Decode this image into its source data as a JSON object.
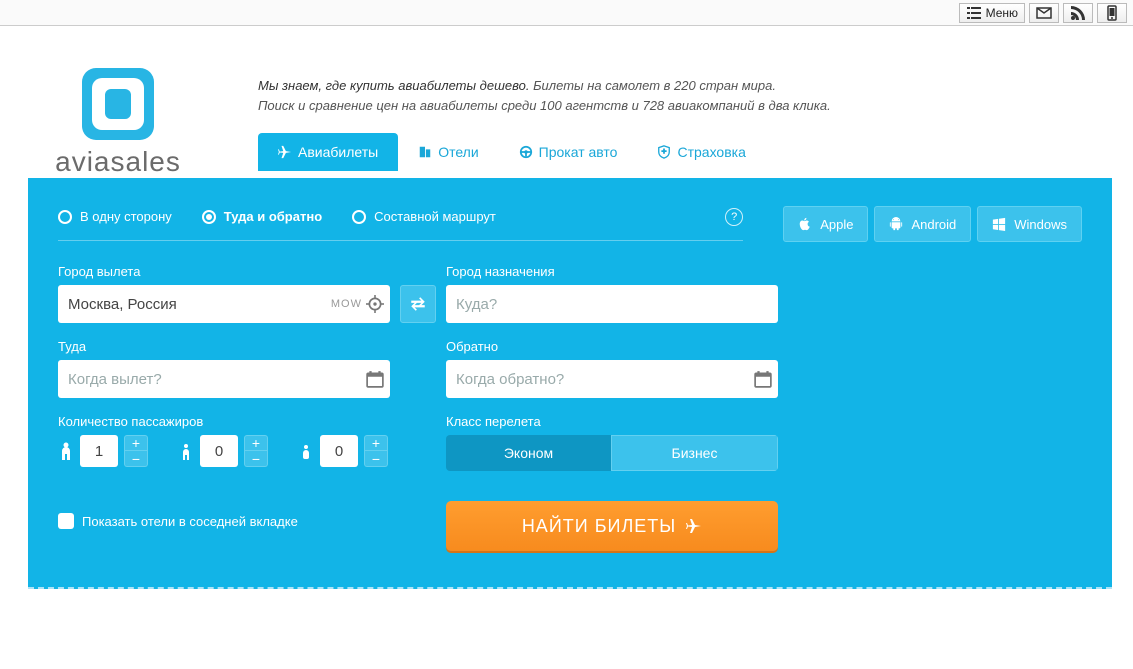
{
  "topbar": {
    "menu": "Меню"
  },
  "logo": {
    "brand": "aviasales"
  },
  "slogan": {
    "line1_bold": "Мы знаем, где купить авиабилеты дешево.",
    "line1_rest": " Билеты на самолет в 220 стран мира.",
    "line2": "Поиск и сравнение цен на авиабилеты среди 100 агентств и 728 авиакомпаний в два клика."
  },
  "tabs": {
    "flights": "Авиабилеты",
    "hotels": "Отели",
    "cars": "Прокат авто",
    "insurance": "Страховка"
  },
  "trip_types": {
    "oneway": "В одну сторону",
    "round": "Туда и обратно",
    "multi": "Составной маршрут"
  },
  "apps": {
    "apple": "Apple",
    "android": "Android",
    "windows": "Windows"
  },
  "form": {
    "from_label": "Город вылета",
    "from_value": "Москва, Россия",
    "from_code": "MOW",
    "to_label": "Город назначения",
    "to_placeholder": "Куда?",
    "depart_label": "Туда",
    "depart_placeholder": "Когда вылет?",
    "return_label": "Обратно",
    "return_placeholder": "Когда обратно?",
    "pax_label": "Количество пассажиров",
    "pax_adult": "1",
    "pax_child": "0",
    "pax_infant": "0",
    "class_label": "Класс перелета",
    "class_econ": "Эконом",
    "class_biz": "Бизнес",
    "show_hotels": "Показать отели в соседней вкладке",
    "search": "НАЙТИ БИЛЕТЫ"
  }
}
